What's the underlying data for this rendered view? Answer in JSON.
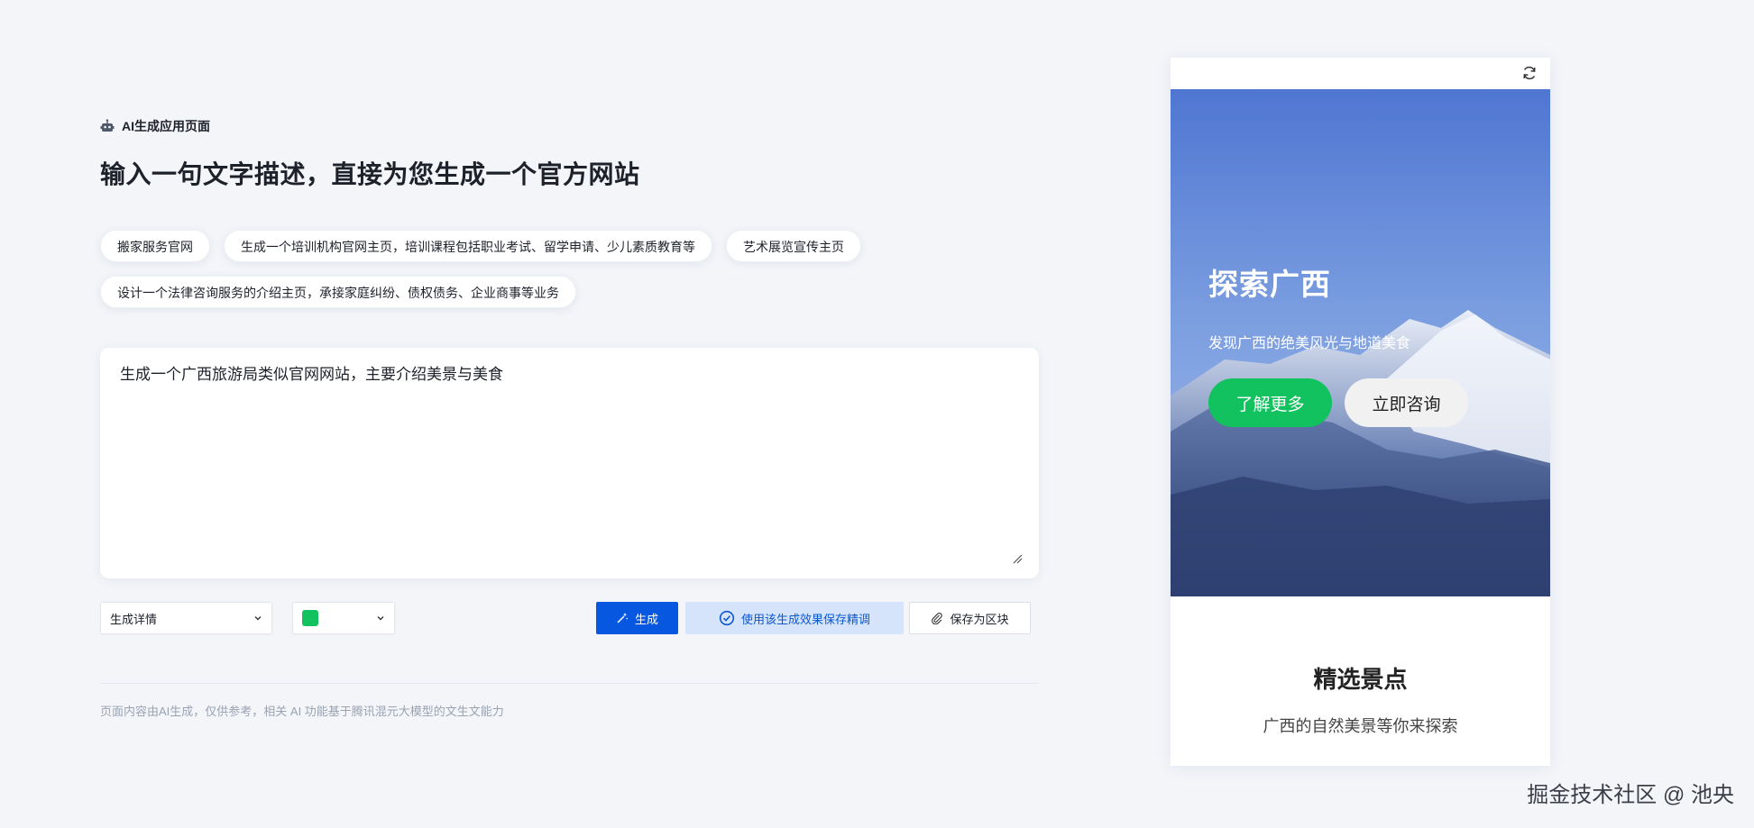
{
  "header": {
    "eyebrow": "AI生成应用页面",
    "title": "输入一句文字描述，直接为您生成一个官方网站"
  },
  "suggestions": [
    "搬家服务官网",
    "生成一个培训机构官网主页，培训课程包括职业考试、留学申请、少儿素质教育等",
    "艺术展览宣传主页",
    "设计一个法律咨询服务的介绍主页，承接家庭纠纷、债权债务、企业商事等业务"
  ],
  "prompt": {
    "value": "生成一个广西旅游局类似官网网站，主要介绍美景与美食"
  },
  "toolbar": {
    "detail_select": "生成详情",
    "color_value": "#12c25e",
    "generate_label": "生成",
    "save_tune_label": "使用该生成效果保存精调",
    "save_block_label": "保存为区块"
  },
  "footer_note": "页面内容由AI生成，仅供参考，相关 AI 功能基于腾讯混元大模型的文生文能力",
  "preview": {
    "hero_title": "探索广西",
    "hero_subtitle": "发现广西的绝美风光与地道美食",
    "primary_button": "了解更多",
    "secondary_button": "立即咨询",
    "section_title": "精选景点",
    "section_subtitle": "广西的自然美景等你来探索"
  },
  "watermark": "掘金技术社区 @ 池央",
  "colors": {
    "primary": "#0757e0",
    "accent_green": "#12c25e",
    "background": "#f3f5f9"
  }
}
